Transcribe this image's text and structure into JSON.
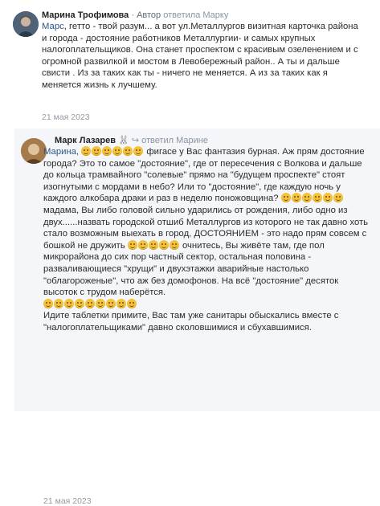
{
  "comment1": {
    "author": "Марина Трофимова",
    "role_separator": " · ",
    "role": "Автор",
    "reply_prefix": " ответила ",
    "reply_to": "Марку",
    "mention": "Марс",
    "body": ", гетто - твой разум... а вот ул.Металлургов визитная карточка района и города - достояние работников Металлургии- и самых крупных налогоплательщиков. Она станет проспектом с красивым озеленением и с огромной развилкой и мостом в Левобережный район.. А ты и дальше свисти . Из за таких как ты - ничего не меняется. А из за таких как я меняется жизнь к лучшему.",
    "date": "21 мая 2023"
  },
  "comment2": {
    "author": "Марк Лазарев",
    "badge_icon": "bunny-icon",
    "reply_prefix": "ответил ",
    "reply_to": "Марине",
    "mention": "Марина,",
    "segments": [
      " фигасе у Вас фантазия бурная. Аж прям достояние города? Это то самое \"достояние\", где от пересечения с Волкова и дальше до кольца трамвайного \"солевые\" прямо на \"будущем проспекте\" стоят изогнутыми с мордами в небо? Или то \"достояние\", где каждую ночь у каждого алкобара драки и раз в неделю поножовщина? ",
      " мадама, Вы либо головой сильно ударились от рождения, либо одно из двух......назвать городской отшиб Металлургов из которого не так давно хоть стало возможным выехать в город, ДОСТОЯНИЕМ - это надо прям совсем с бошкой не дружить ",
      " очнитесь, Вы живёте там, где пол микрорайона до сих пор частный сектор, остальная половина - разваливающиеся \"хрущи\" и двухэтажки аварийные настолько \"облагороженые\", что аж без домофонов. На всё \"достояние\" десяток высоток с трудом наберётся.",
      "Идите таблетки примите, Вас там уже санитары обыскались вместе с \"налогоплательщиками\" давно сколовшимися и сбухавшимися."
    ],
    "date": "21 мая 2023"
  },
  "icons": {
    "emoji": "grinning-squinting-face-icon",
    "reply_arrow": "reply-arrow-icon"
  }
}
